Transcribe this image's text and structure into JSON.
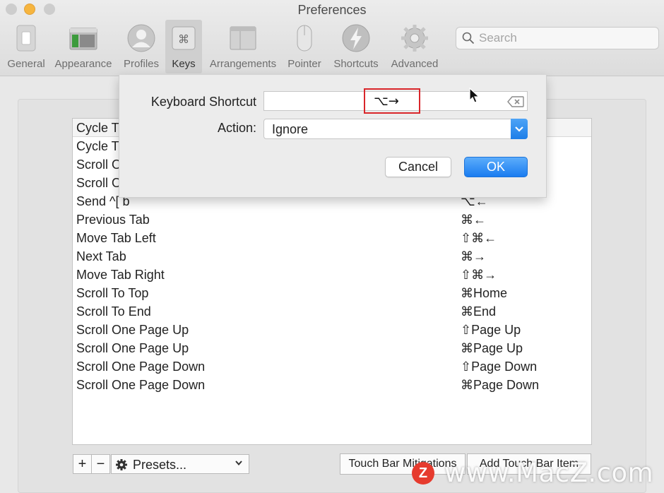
{
  "window": {
    "title": "Preferences"
  },
  "toolbar": {
    "tabs": [
      {
        "label": "General",
        "icon": "general-switch-icon"
      },
      {
        "label": "Appearance",
        "icon": "appearance-window-icon"
      },
      {
        "label": "Profiles",
        "icon": "profile-person-icon"
      },
      {
        "label": "Keys",
        "icon": "command-key-icon",
        "selected": true
      },
      {
        "label": "Arrangements",
        "icon": "arrangements-window-icon"
      },
      {
        "label": "Pointer",
        "icon": "mouse-pointer-icon"
      },
      {
        "label": "Shortcuts",
        "icon": "lightning-bolt-icon"
      },
      {
        "label": "Advanced",
        "icon": "gear-icon"
      }
    ],
    "search": {
      "placeholder": "Search",
      "value": ""
    }
  },
  "key_bindings": {
    "rows": [
      {
        "action": "Cycle T",
        "shortcut": ""
      },
      {
        "action": "Cycle T",
        "shortcut": ""
      },
      {
        "action": "Scroll O",
        "shortcut": ""
      },
      {
        "action": "Scroll O",
        "shortcut": ""
      },
      {
        "action": "Send ^[ b",
        "shortcut": "⌥←"
      },
      {
        "action": "Previous Tab",
        "shortcut": "⌘←"
      },
      {
        "action": "Move Tab Left",
        "shortcut": "⇧⌘←"
      },
      {
        "action": "Next Tab",
        "shortcut": "⌘→"
      },
      {
        "action": "Move Tab Right",
        "shortcut": "⇧⌘→"
      },
      {
        "action": "Scroll To Top",
        "shortcut": "⌘Home"
      },
      {
        "action": "Scroll To End",
        "shortcut": "⌘End"
      },
      {
        "action": "Scroll One Page Up",
        "shortcut": "⇧Page Up"
      },
      {
        "action": "Scroll One Page Up",
        "shortcut": "⌘Page Up"
      },
      {
        "action": "Scroll One Page Down",
        "shortcut": "⇧Page Down"
      },
      {
        "action": "Scroll One Page Down",
        "shortcut": "⌘Page Down"
      }
    ]
  },
  "bottom_bar": {
    "add_label": "+",
    "remove_label": "−",
    "presets_label": "Presets...",
    "touch_bar_mitigations_label": "Touch Bar Mitigations",
    "add_touch_bar_item_label": "Add Touch Bar Item"
  },
  "sheet": {
    "shortcut_label": "Keyboard Shortcut",
    "shortcut_value": "⌥→",
    "action_label": "Action:",
    "action_value": "Ignore",
    "cancel_label": "Cancel",
    "ok_label": "OK",
    "highlight_color": "#d9262a",
    "accent_color": "#1a7cf0"
  },
  "watermark": {
    "badge": "Z",
    "text": "www.MacZ.com"
  }
}
